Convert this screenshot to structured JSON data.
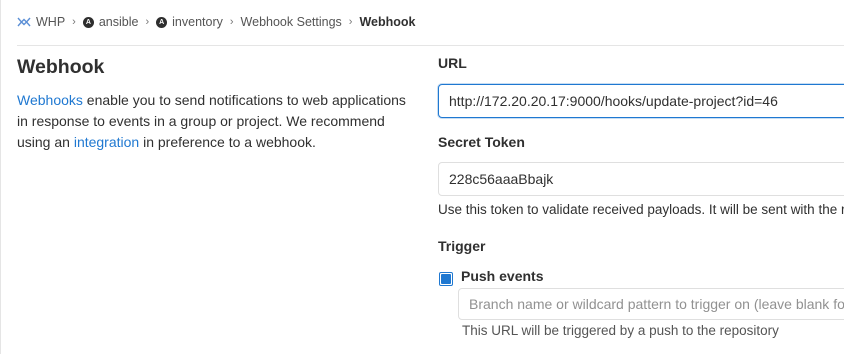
{
  "breadcrumb": {
    "items": [
      {
        "label": "WHP",
        "icon": "group-logo-icon"
      },
      {
        "label": "ansible",
        "icon": "avatar-icon"
      },
      {
        "label": "inventory",
        "icon": "avatar-icon"
      },
      {
        "label": "Webhook Settings"
      },
      {
        "label": "Webhook"
      }
    ]
  },
  "section": {
    "title": "Webhook",
    "intro_link1": "Webhooks",
    "intro_text1": " enable you to send notifications to web applications in response to events in a group or project. We recommend using an ",
    "intro_link2": "integration",
    "intro_text2": " in preference to a webhook."
  },
  "form": {
    "url_label": "URL",
    "url_value": "http://172.20.20.17:9000/hooks/update-project?id=46",
    "token_label": "Secret Token",
    "token_value": "228c56aaaBbajk",
    "token_help": "Use this token to validate received payloads. It will be sent with the request in the X-Gitlab-Token HTTP header.",
    "trigger_label": "Trigger",
    "push_events_label": "Push events",
    "push_events_checked": true,
    "branch_placeholder": "Branch name or wildcard pattern to trigger on (leave blank for all)",
    "push_events_help": "This URL will be triggered by a push to the repository"
  },
  "colors": {
    "link": "#1f78d1",
    "text": "#303030",
    "border": "#dfdfdf"
  }
}
